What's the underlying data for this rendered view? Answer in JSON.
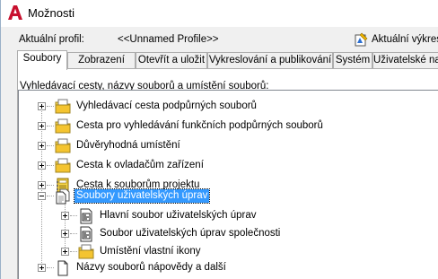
{
  "window": {
    "title": "Možnosti"
  },
  "profile": {
    "label": "Aktuální profil:",
    "value": "<<Unnamed Profile>>",
    "drawing_label": "Aktuální výkres"
  },
  "tabs": [
    {
      "label": "Soubory",
      "active": true
    },
    {
      "label": "Zobrazení",
      "active": false
    },
    {
      "label": "Otevřít a uložit",
      "active": false
    },
    {
      "label": "Vykreslování a publikování",
      "active": false
    },
    {
      "label": "Systém",
      "active": false
    },
    {
      "label": "Uživatelské nast",
      "active": false
    }
  ],
  "files_tab": {
    "caption": "Vyhledávací cesty, názvy souborů a umístění souborů:",
    "tree": [
      {
        "label": "Vyhledávací cesta podpůrných souborů",
        "icon": "folder-icon",
        "expanded": false,
        "selected": false
      },
      {
        "label": "Cesta pro vyhledávání funkčních podpůrných souborů",
        "icon": "folder-icon",
        "expanded": false,
        "selected": false
      },
      {
        "label": "Důvěryhodná umístění",
        "icon": "folder-icon",
        "expanded": false,
        "selected": false
      },
      {
        "label": "Cesta k ovladačům zařízení",
        "icon": "folder-icon",
        "expanded": false,
        "selected": false
      },
      {
        "label": "Cesta k souborům projektu",
        "icon": "project-icon",
        "expanded": false,
        "selected": false
      },
      {
        "label": "Soubory uživatelských úprav",
        "icon": "documents-icon",
        "expanded": true,
        "selected": true,
        "children": [
          {
            "label": "Hlavní soubor uživatelských úprav",
            "icon": "cui-file-icon"
          },
          {
            "label": "Soubor uživatelských úprav společnosti",
            "icon": "cui-file-icon"
          },
          {
            "label": "Umístění vlastní ikony",
            "icon": "folder-icon"
          }
        ]
      },
      {
        "label": "Názvy souborů nápovědy a další",
        "icon": "document-icon",
        "expanded": false,
        "selected": false
      }
    ]
  },
  "colors": {
    "selection": "#3399ff",
    "folder": "#f7d64a",
    "brand_red": "#c8102e"
  }
}
